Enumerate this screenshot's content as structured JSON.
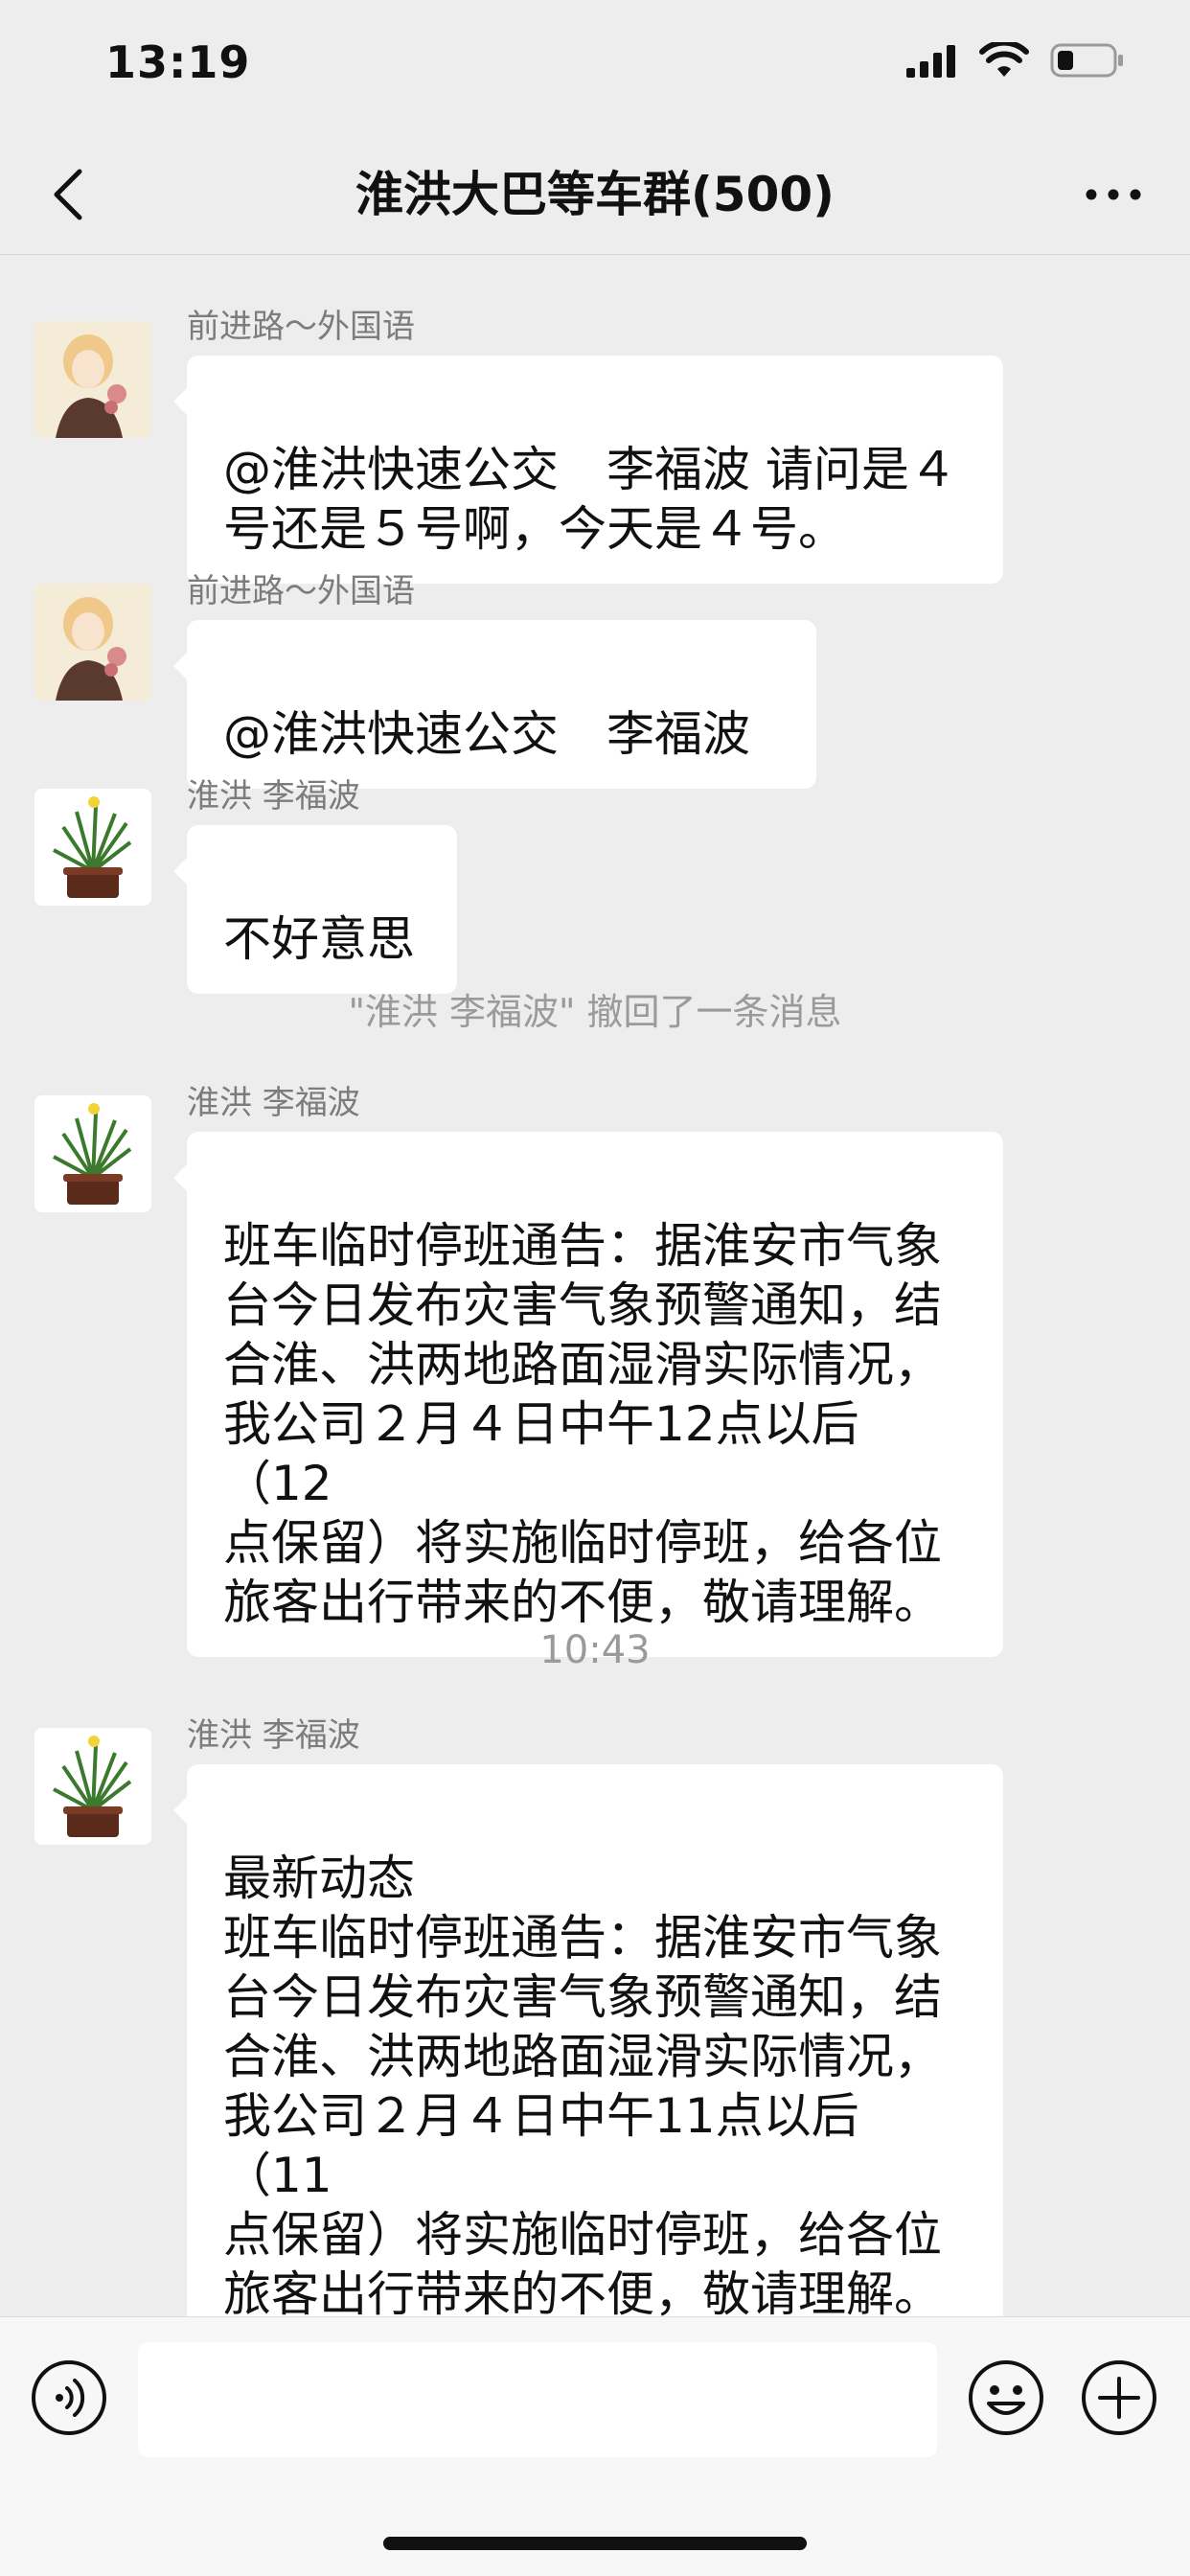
{
  "status_bar": {
    "time": "13:19"
  },
  "nav": {
    "title": "淮洪大巴等车群(500)"
  },
  "messages": [
    {
      "sender": "前进路～外国语",
      "text": "@淮洪快速公交　李福波 请问是４\n号还是５号啊，今天是４号。"
    },
    {
      "sender": "前进路～外国语",
      "text": "@淮洪快速公交　李福波"
    },
    {
      "sender": "淮洪 李福波",
      "text": "不好意思"
    },
    {
      "sender": "淮洪 李福波",
      "text": "班车临时停班通告：据淮安市气象\n台今日发布灾害气象预警通知，结\n合淮、洪两地路面湿滑实际情况，\n我公司２月４日中午12点以后（12\n点保留）将实施临时停班，给各位\n旅客出行带来的不便，敬请理解。"
    },
    {
      "sender": "淮洪 李福波",
      "text": "最新动态\n班车临时停班通告：据淮安市气象\n台今日发布灾害气象预警通知，结\n合淮、洪两地路面湿滑实际情况，\n我公司２月４日中午11点以后（11\n点保留）将实施临时停班，给各位\n旅客出行带来的不便，敬请理解。"
    }
  ],
  "system_notice": "\"淮洪 李福波\" 撤回了一条消息",
  "timestamp": "10:43",
  "input": {
    "placeholder": ""
  },
  "icons": {
    "back": "chevron-left-icon",
    "more": "more-dots-icon",
    "voice": "voice-icon",
    "emoji": "emoji-icon",
    "plus": "plus-icon"
  }
}
